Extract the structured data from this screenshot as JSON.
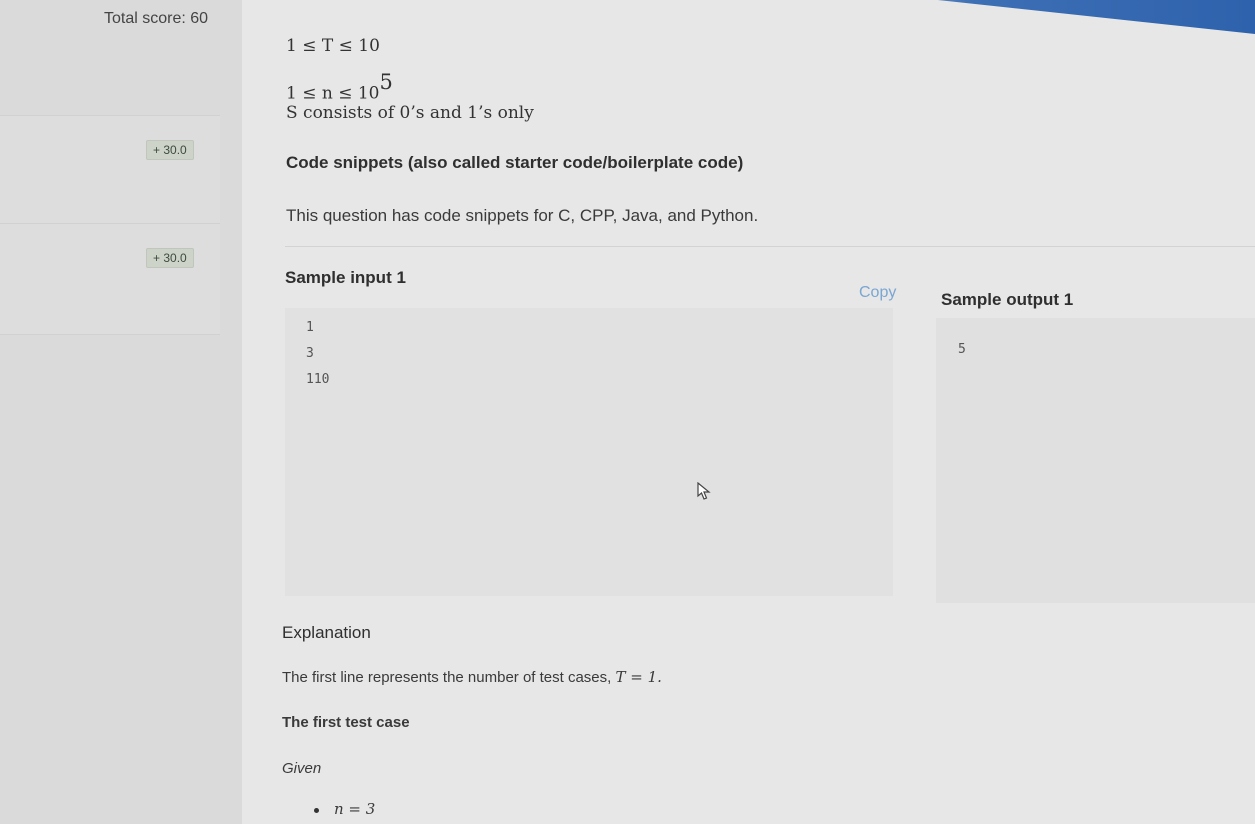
{
  "sidebar": {
    "total_score": "Total score: 60",
    "sections": [
      {
        "badge": "+ 30.0"
      },
      {
        "badge": "+ 30.0"
      }
    ]
  },
  "constraints": {
    "t": "1 ≤ T ≤ 10",
    "n_prefix": "1 ≤ n ≤ 10",
    "n_exp": "5",
    "s": "S consists of 0’s and 1’s only"
  },
  "snippets": {
    "heading": "Code snippets (also called starter code/boilerplate code)",
    "text": "This question has code snippets for C, CPP, Java, and Python."
  },
  "sample_input": {
    "title": "Sample input 1",
    "copy_label": "Copy",
    "lines": [
      "1",
      "3",
      "110"
    ]
  },
  "sample_output": {
    "title": "Sample output 1",
    "lines": [
      "5"
    ]
  },
  "explanation": {
    "heading": "Explanation",
    "first_line_prefix": "The first line represents the number of test cases,",
    "first_line_math": "T = 1.",
    "case_heading": "The first test case",
    "given": "Given",
    "bullets": [
      "n = 3"
    ]
  }
}
